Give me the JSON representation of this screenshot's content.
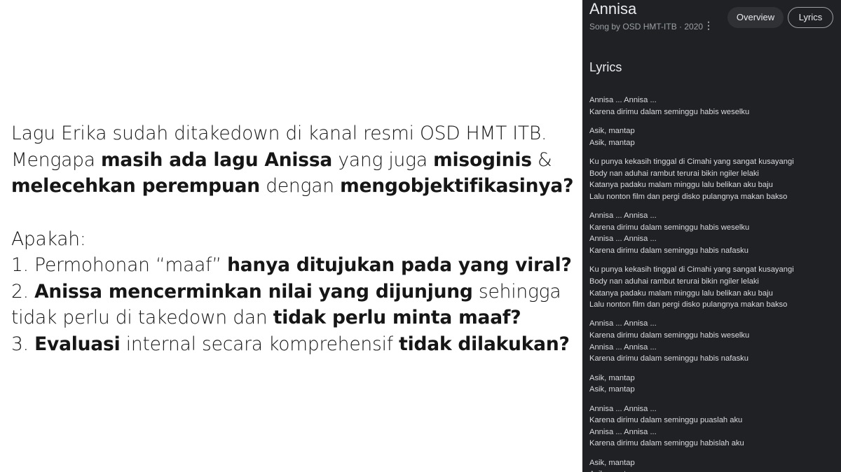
{
  "left_text": {
    "lines": [
      [
        {
          "t": "Lagu Erika sudah ditakedown di kanal resmi OSD HMT ITB.",
          "b": false
        }
      ],
      [
        {
          "t": "Mengapa ",
          "b": false
        },
        {
          "t": "masih ada lagu Anissa",
          "b": true
        },
        {
          "t": " yang  juga ",
          "b": false
        },
        {
          "t": "misoginis",
          "b": true
        },
        {
          "t": " &",
          "b": false
        }
      ],
      [
        {
          "t": "melecehkan perempuan",
          "b": true
        },
        {
          "t": " dengan ",
          "b": false
        },
        {
          "t": "mengobjektifikasinya?",
          "b": true
        }
      ],
      [],
      [
        {
          "t": "Apakah:",
          "b": false
        }
      ],
      [
        {
          "t": "1. Permohonan “maaf” ",
          "b": false
        },
        {
          "t": "hanya ditujukan pada yang viral?",
          "b": true
        }
      ],
      [
        {
          "t": "2. ",
          "b": false
        },
        {
          "t": "Anissa mencerminkan nilai yang dijunjung",
          "b": true
        },
        {
          "t": " sehingga",
          "b": false
        }
      ],
      [
        {
          "t": "tidak perlu di takedown dan ",
          "b": false
        },
        {
          "t": "tidak perlu minta maaf?",
          "b": true
        }
      ],
      [
        {
          "t": "3. ",
          "b": false
        },
        {
          "t": "Evaluasi",
          "b": true
        },
        {
          "t": " internal secara komprehensif ",
          "b": false
        },
        {
          "t": "tidak dilakukan?",
          "b": true
        }
      ]
    ]
  },
  "panel": {
    "title": "Annisa",
    "subtitle": "Song by OSD HMT-ITB · 2020",
    "more_icon": "⋮",
    "tabs": [
      {
        "label": "Overview"
      },
      {
        "label": "Lyrics"
      }
    ],
    "lyrics_heading": "Lyrics",
    "stanzas": [
      [
        "Annisa ... Annisa ...",
        "Karena dirimu dalam seminggu habis weselku"
      ],
      [
        "Asik, mantap",
        "Asik, mantap"
      ],
      [
        "Ku punya kekasih tinggal di Cimahi yang sangat kusayangi",
        "Body nan aduhai rambut terurai bikin ngiler lelaki",
        "Katanya padaku malam minggu lalu belikan aku baju",
        "Lalu nonton film dan pergi disko pulangnya makan bakso"
      ],
      [
        "Annisa ... Annisa ...",
        "Karena dirimu dalam seminggu habis weselku",
        "Annisa ... Annisa ...",
        "Karena dirimu dalam seminggu habis nafasku"
      ],
      [
        "Ku punya kekasih tinggal di Cimahi yang sangat kusayangi",
        "Body nan aduhai rambut terurai bikin ngiler lelaki",
        "Katanya padaku malam minggu lalu belikan aku baju",
        "Lalu nonton film dan pergi disko pulangnya makan bakso"
      ],
      [
        "Annisa ... Annisa ...",
        "Karena dirimu dalam seminggu habis weselku",
        "Annisa ... Annisa ...",
        "Karena dirimu dalam seminggu habis nafasku"
      ],
      [
        "Asik, mantap",
        "Asik, mantap"
      ],
      [
        "Annisa ... Annisa ...",
        "Karena dirimu dalam seminggu puaslah aku",
        "Annisa ... Annisa ...",
        "Karena dirimu dalam seminggu habislah aku"
      ],
      [
        "Asik, mantap",
        "Asik, mantap"
      ]
    ]
  }
}
